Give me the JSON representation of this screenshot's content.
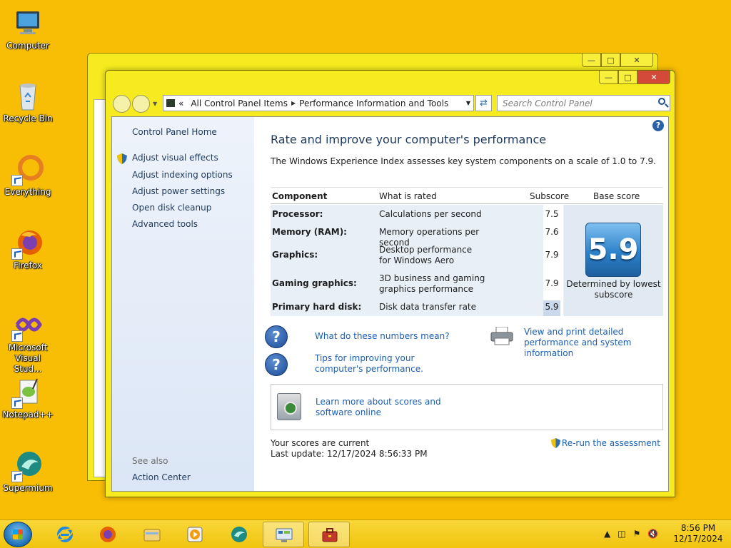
{
  "desktop": {
    "icons": [
      {
        "label": "Computer"
      },
      {
        "label": "Recycle Bin"
      },
      {
        "label": "Everything"
      },
      {
        "label": "Firefox"
      },
      {
        "label": "Microsoft Visual Stud..."
      },
      {
        "label": "Notepad++"
      },
      {
        "label": "Supermium"
      }
    ]
  },
  "window": {
    "address": {
      "overflow": "«",
      "parts": [
        "All Control Panel Items",
        "Performance Information and Tools"
      ]
    },
    "search_placeholder": "Search Control Panel",
    "sidebar": {
      "home": "Control Panel Home",
      "links": [
        "Adjust visual effects",
        "Adjust indexing options",
        "Adjust power settings",
        "Open disk cleanup",
        "Advanced tools"
      ],
      "see_also": "See also",
      "see_also_links": [
        "Action Center"
      ]
    },
    "main": {
      "title": "Rate and improve your computer's performance",
      "intro": "The Windows Experience Index assesses key system components on a scale of 1.0 to 7.9.",
      "columns": {
        "component": "Component",
        "rated": "What is rated",
        "subscore": "Subscore",
        "base": "Base score"
      },
      "rows": [
        {
          "component": "Processor:",
          "rated": "Calculations per second",
          "subscore": "7.5"
        },
        {
          "component": "Memory (RAM):",
          "rated": "Memory operations per second",
          "subscore": "7.6"
        },
        {
          "component": "Graphics:",
          "rated": "Desktop performance for Windows Aero",
          "subscore": "7.9"
        },
        {
          "component": "Gaming graphics:",
          "rated": "3D business and gaming graphics performance",
          "subscore": "7.9"
        },
        {
          "component": "Primary hard disk:",
          "rated": "Disk data transfer rate",
          "subscore": "5.9"
        }
      ],
      "base_score": "5.9",
      "base_caption": "Determined by lowest subscore",
      "links": {
        "numbers": "What do these numbers mean?",
        "tips": "Tips for improving your computer's performance.",
        "print": "View and print detailed performance and system information",
        "learn": "Learn more about scores and software online"
      },
      "status_line1": "Your scores are current",
      "status_line2": "Last update: 12/17/2024 8:56:33 PM",
      "rerun": "Re-run the assessment"
    }
  },
  "taskbar": {
    "time": "8:56 PM",
    "date": "12/17/2024"
  },
  "colors": {
    "desktop": "#F8BE05",
    "window_frame": "#F5EB1E",
    "link": "#1a5fb4",
    "heading": "#1e395b"
  }
}
